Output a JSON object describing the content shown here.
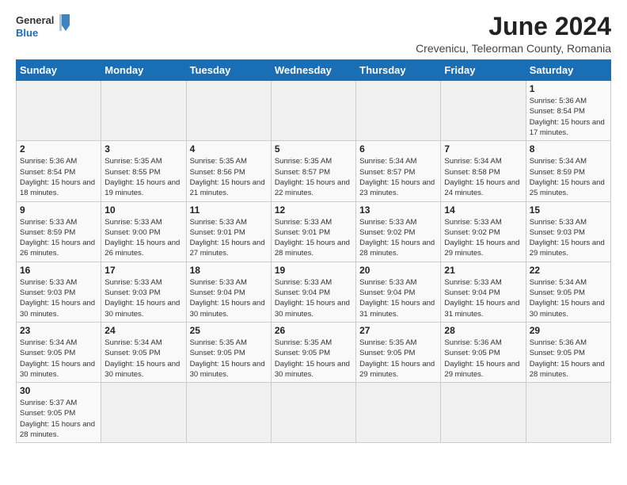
{
  "header": {
    "logo_general": "General",
    "logo_blue": "Blue",
    "month_title": "June 2024",
    "subtitle": "Crevenicu, Teleorman County, Romania"
  },
  "days_of_week": [
    "Sunday",
    "Monday",
    "Tuesday",
    "Wednesday",
    "Thursday",
    "Friday",
    "Saturday"
  ],
  "weeks": [
    [
      {
        "day": "",
        "info": ""
      },
      {
        "day": "",
        "info": ""
      },
      {
        "day": "",
        "info": ""
      },
      {
        "day": "",
        "info": ""
      },
      {
        "day": "",
        "info": ""
      },
      {
        "day": "",
        "info": ""
      },
      {
        "day": "1",
        "info": "Sunrise: 5:36 AM\nSunset: 8:54 PM\nDaylight: 15 hours and 17 minutes."
      }
    ],
    [
      {
        "day": "2",
        "info": "Sunrise: 5:36 AM\nSunset: 8:54 PM\nDaylight: 15 hours and 18 minutes."
      },
      {
        "day": "3",
        "info": "Sunrise: 5:35 AM\nSunset: 8:55 PM\nDaylight: 15 hours and 19 minutes."
      },
      {
        "day": "4",
        "info": "Sunrise: 5:35 AM\nSunset: 8:56 PM\nDaylight: 15 hours and 21 minutes."
      },
      {
        "day": "5",
        "info": "Sunrise: 5:35 AM\nSunset: 8:57 PM\nDaylight: 15 hours and 22 minutes."
      },
      {
        "day": "6",
        "info": "Sunrise: 5:34 AM\nSunset: 8:57 PM\nDaylight: 15 hours and 23 minutes."
      },
      {
        "day": "7",
        "info": "Sunrise: 5:34 AM\nSunset: 8:58 PM\nDaylight: 15 hours and 24 minutes."
      },
      {
        "day": "8",
        "info": "Sunrise: 5:34 AM\nSunset: 8:59 PM\nDaylight: 15 hours and 25 minutes."
      }
    ],
    [
      {
        "day": "9",
        "info": "Sunrise: 5:33 AM\nSunset: 8:59 PM\nDaylight: 15 hours and 26 minutes."
      },
      {
        "day": "10",
        "info": "Sunrise: 5:33 AM\nSunset: 9:00 PM\nDaylight: 15 hours and 26 minutes."
      },
      {
        "day": "11",
        "info": "Sunrise: 5:33 AM\nSunset: 9:01 PM\nDaylight: 15 hours and 27 minutes."
      },
      {
        "day": "12",
        "info": "Sunrise: 5:33 AM\nSunset: 9:01 PM\nDaylight: 15 hours and 28 minutes."
      },
      {
        "day": "13",
        "info": "Sunrise: 5:33 AM\nSunset: 9:02 PM\nDaylight: 15 hours and 28 minutes."
      },
      {
        "day": "14",
        "info": "Sunrise: 5:33 AM\nSunset: 9:02 PM\nDaylight: 15 hours and 29 minutes."
      },
      {
        "day": "15",
        "info": "Sunrise: 5:33 AM\nSunset: 9:03 PM\nDaylight: 15 hours and 29 minutes."
      }
    ],
    [
      {
        "day": "16",
        "info": "Sunrise: 5:33 AM\nSunset: 9:03 PM\nDaylight: 15 hours and 30 minutes."
      },
      {
        "day": "17",
        "info": "Sunrise: 5:33 AM\nSunset: 9:03 PM\nDaylight: 15 hours and 30 minutes."
      },
      {
        "day": "18",
        "info": "Sunrise: 5:33 AM\nSunset: 9:04 PM\nDaylight: 15 hours and 30 minutes."
      },
      {
        "day": "19",
        "info": "Sunrise: 5:33 AM\nSunset: 9:04 PM\nDaylight: 15 hours and 30 minutes."
      },
      {
        "day": "20",
        "info": "Sunrise: 5:33 AM\nSunset: 9:04 PM\nDaylight: 15 hours and 31 minutes."
      },
      {
        "day": "21",
        "info": "Sunrise: 5:33 AM\nSunset: 9:04 PM\nDaylight: 15 hours and 31 minutes."
      },
      {
        "day": "22",
        "info": "Sunrise: 5:34 AM\nSunset: 9:05 PM\nDaylight: 15 hours and 30 minutes."
      }
    ],
    [
      {
        "day": "23",
        "info": "Sunrise: 5:34 AM\nSunset: 9:05 PM\nDaylight: 15 hours and 30 minutes."
      },
      {
        "day": "24",
        "info": "Sunrise: 5:34 AM\nSunset: 9:05 PM\nDaylight: 15 hours and 30 minutes."
      },
      {
        "day": "25",
        "info": "Sunrise: 5:35 AM\nSunset: 9:05 PM\nDaylight: 15 hours and 30 minutes."
      },
      {
        "day": "26",
        "info": "Sunrise: 5:35 AM\nSunset: 9:05 PM\nDaylight: 15 hours and 30 minutes."
      },
      {
        "day": "27",
        "info": "Sunrise: 5:35 AM\nSunset: 9:05 PM\nDaylight: 15 hours and 29 minutes."
      },
      {
        "day": "28",
        "info": "Sunrise: 5:36 AM\nSunset: 9:05 PM\nDaylight: 15 hours and 29 minutes."
      },
      {
        "day": "29",
        "info": "Sunrise: 5:36 AM\nSunset: 9:05 PM\nDaylight: 15 hours and 28 minutes."
      }
    ],
    [
      {
        "day": "30",
        "info": "Sunrise: 5:37 AM\nSunset: 9:05 PM\nDaylight: 15 hours and 28 minutes."
      },
      {
        "day": "",
        "info": ""
      },
      {
        "day": "",
        "info": ""
      },
      {
        "day": "",
        "info": ""
      },
      {
        "day": "",
        "info": ""
      },
      {
        "day": "",
        "info": ""
      },
      {
        "day": "",
        "info": ""
      }
    ]
  ]
}
